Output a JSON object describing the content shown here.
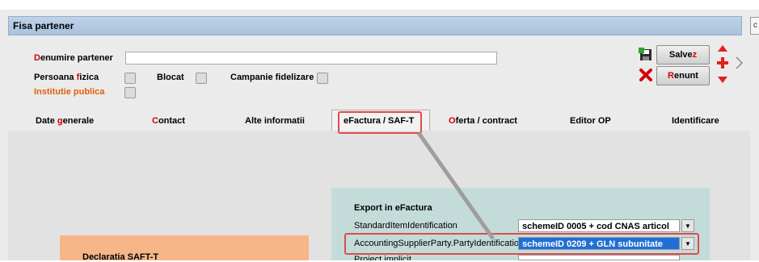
{
  "window": {
    "title": "Fisa partener",
    "corner_glyph": "c"
  },
  "form": {
    "denumire_label": "Denumire partener",
    "denumire_value": "",
    "persoana_fizica_label": "Persoana fizica",
    "blocat_label": "Blocat",
    "campanie_label": "Campanie fidelizare",
    "institutie_label": "Institutie publica"
  },
  "toolbar": {
    "save_label": "Salvez",
    "cancel_label": "Renunt"
  },
  "tabs": [
    {
      "label": "Date generale"
    },
    {
      "label": "Contact"
    },
    {
      "label": "Alte informatii"
    },
    {
      "label": "eFactura / SAF-T"
    },
    {
      "label": "Oferta / contract"
    },
    {
      "label": "Editor OP"
    },
    {
      "label": "Identificare"
    }
  ],
  "efactura": {
    "title": "Export in eFactura",
    "row1_label": "StandardItemIdentification",
    "row1_value": "schemeID  0005 + cod CNAS articol",
    "row2_label": "AccountingSupplierParty.PartyIdentification",
    "row2_value": "schemeID  0209 + GLN subunitate",
    "row3_label": "Proiect implicit"
  },
  "saft": {
    "title": "Declaratia SAFT-T"
  },
  "colors": {
    "accent_red": "#e04b4b",
    "selection_blue": "#1f6fd6",
    "efactura_bg": "#c3dcda",
    "saft_bg": "#f7b687"
  }
}
